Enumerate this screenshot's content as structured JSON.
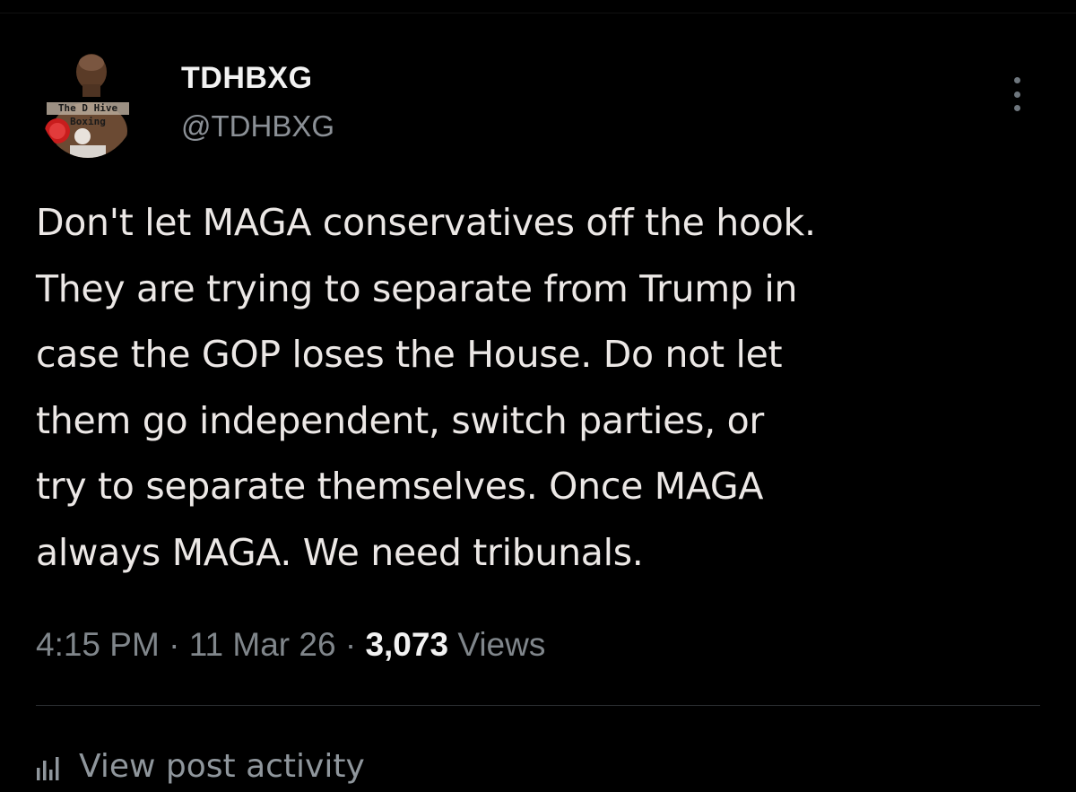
{
  "author": {
    "display_name": "TDHBXG",
    "handle": "@TDHBXG",
    "avatar_text_line1": "The D Hive",
    "avatar_text_line2": "Boxing"
  },
  "post": {
    "lines": [
      "Don't let MAGA conservatives off the hook.",
      "They are trying to separate from Trump in",
      "case the GOP loses the House. Do not let",
      "them go independent, switch parties, or",
      "try to separate themselves. Once MAGA",
      "always MAGA. We need tribunals."
    ]
  },
  "meta": {
    "time": "4:15 PM",
    "separator": " · ",
    "date": "11 Mar 26",
    "views_count": "3,073",
    "views_label": "Views"
  },
  "actions": {
    "view_activity": "View post activity"
  },
  "colors": {
    "background": "#000000",
    "text": "#ece8e6",
    "muted": "#80868b"
  }
}
